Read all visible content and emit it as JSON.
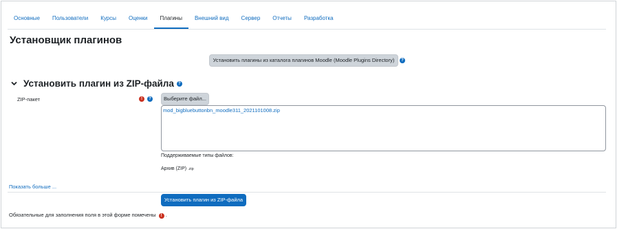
{
  "tabs": [
    {
      "label": "Основные"
    },
    {
      "label": "Пользователи"
    },
    {
      "label": "Курсы"
    },
    {
      "label": "Оценки"
    },
    {
      "label": "Плагины",
      "active": true
    },
    {
      "label": "Внешний вид"
    },
    {
      "label": "Сервер"
    },
    {
      "label": "Отчеты"
    },
    {
      "label": "Разработка"
    }
  ],
  "page": {
    "title": "Установщик плагинов",
    "directory_button": "Установить плагины из каталога плагинов Moodle (Moodle Plugins Directory)"
  },
  "section": {
    "title": "Установить плагин из ZIP-файла",
    "zip_label": "ZIP-пакет",
    "choose_file_button": "Выберите файл...",
    "selected_file": "mod_bigbluebuttonbn_moodle311_2021101008.zip",
    "supported_types_label": "Поддерживаемые типы файлов:",
    "archive_type": "Архив (ZIP)",
    "archive_ext": ".zip"
  },
  "footer": {
    "show_more": "Показать больше ...",
    "submit_button": "Установить плагин из ZIP-файла",
    "required_note": "Обязательные для заполнения поля в этой форме помечены",
    "required_note_end": "."
  },
  "icons": {
    "help": "question-circle-icon",
    "required": "exclamation-circle-icon",
    "chevron": "chevron-down-icon"
  },
  "colors": {
    "accent": "#0f6cbf",
    "required": "#ca3120",
    "secondary_button": "#ced4da"
  }
}
